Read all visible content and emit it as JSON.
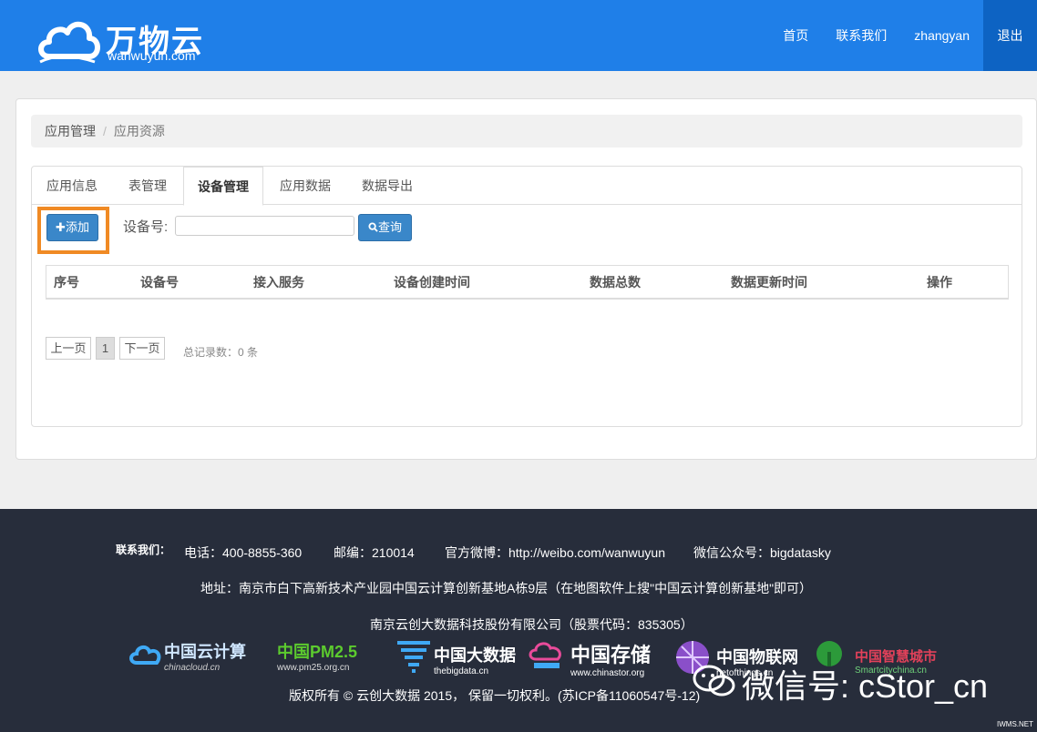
{
  "header": {
    "logo_text": "万物云",
    "logo_sub": "wanwuyun.com",
    "nav": [
      "首页",
      "联系我们",
      "zhangyan",
      "退出"
    ]
  },
  "breadcrumb": {
    "parent": "应用管理",
    "sep": "/",
    "current": "应用资源"
  },
  "tabs": [
    "应用信息",
    "表管理",
    "设备管理",
    "应用数据",
    "数据导出"
  ],
  "toolbar": {
    "add_label": "✚添加",
    "device_label": "设备号:",
    "device_value": "",
    "query_label": "查询"
  },
  "table": {
    "columns": [
      "序号",
      "设备号",
      "接入服务",
      "设备创建时间",
      "数据总数",
      "数据更新时间",
      "操作"
    ],
    "rows": []
  },
  "pagination": {
    "prev": "上一页",
    "page": "1",
    "next": "下一页",
    "total": "总记录数：0 条"
  },
  "footer": {
    "contact_label": "联系我们：",
    "phone": "电话：400-8855-360",
    "zip": "邮编：210014",
    "weibo": "官方微博：http://weibo.com/wanwuyun",
    "wechat": "微信公众号：bigdatasky",
    "address": "地址：南京市白下高新技术产业园中国云计算创新基地A栋9层（在地图软件上搜\"中国云计算创新基地\"即可）",
    "company": "南京云创大数据科技股份有限公司（股票代码：835305）",
    "copyright": "版权所有 © 云创大数据 2015， 保留一切权利。(苏ICP备11060547号-12)",
    "logos": [
      {
        "name": "中国云计算",
        "sub": "chinacloud.cn"
      },
      {
        "name": "中国PM2.5",
        "sub": "www.pm25.org.cn"
      },
      {
        "name": "中国大数据",
        "sub": "thebigdata.cn"
      },
      {
        "name": "中国存储",
        "sub": "www.chinastor.org"
      },
      {
        "name": "中国物联网",
        "sub": "netofthings.cn"
      },
      {
        "name": "中国智慧城市",
        "sub": "Smartcitychina.cn"
      }
    ]
  },
  "watermark": {
    "text": "微信号: cStor_cn",
    "corner": "IWMS.NET"
  },
  "colors": {
    "navbar": "#1f7fe8",
    "button": "#3a87c9",
    "highlight": "#f08a24",
    "footer": "#272d3b"
  }
}
